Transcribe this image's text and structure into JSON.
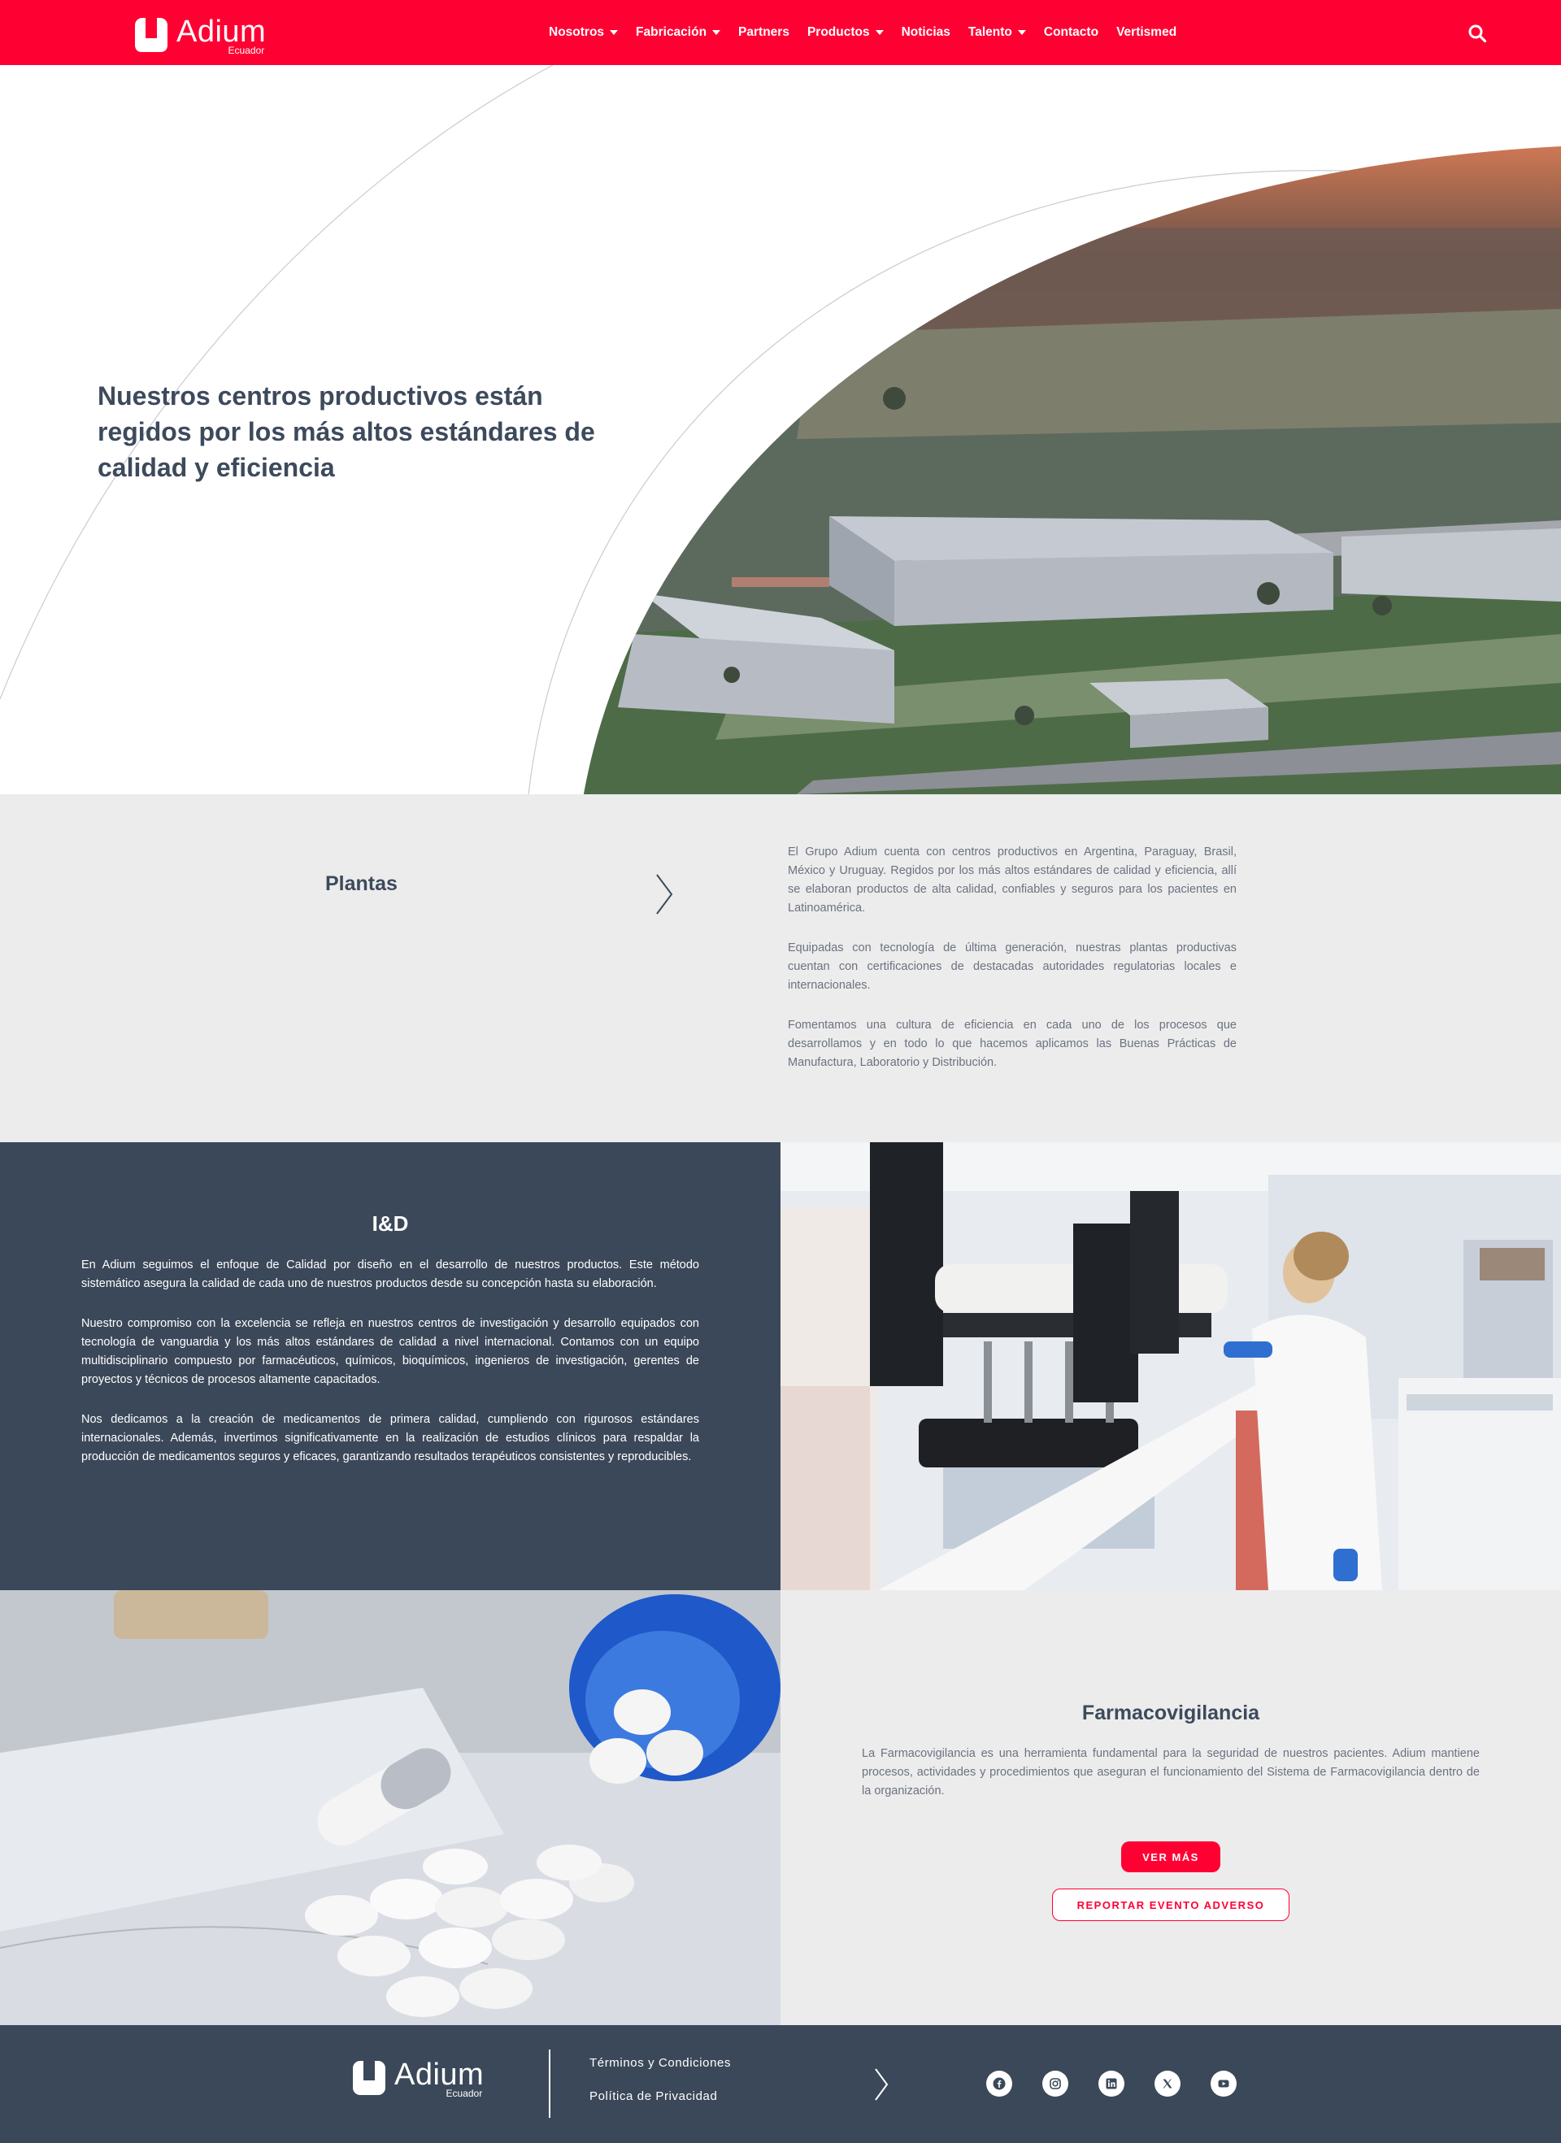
{
  "brand": {
    "name": "Adium",
    "country": "Ecuador"
  },
  "nav": {
    "items": [
      {
        "label": "Nosotros",
        "dropdown": true
      },
      {
        "label": "Fabricación",
        "dropdown": true
      },
      {
        "label": "Partners",
        "dropdown": false
      },
      {
        "label": "Productos",
        "dropdown": true
      },
      {
        "label": "Noticias",
        "dropdown": false
      },
      {
        "label": "Talento",
        "dropdown": true
      },
      {
        "label": "Contacto",
        "dropdown": false
      },
      {
        "label": "Vertismed",
        "dropdown": false
      }
    ],
    "search_icon": "search-icon"
  },
  "hero": {
    "title": "Nuestros centros productivos están regidos por los más altos estándares de calidad y eficiencia"
  },
  "plantas": {
    "heading": "Plantas",
    "paragraphs": [
      "El Grupo Adium cuenta con  centros productivos en Argentina, Paraguay, Brasil, México y Uruguay. Regidos por los más altos estándares de calidad y eficiencia, allí se elaboran productos de alta calidad, confiables y seguros para los pacientes en Latinoamérica.",
      "Equipadas con tecnología de última generación, nuestras plantas productivas cuentan con certificaciones de destacadas autoridades regulatorias locales e internacionales.",
      "Fomentamos una cultura de eficiencia en cada uno de los procesos que desarrollamos y en todo lo que hacemos aplicamos las Buenas Prácticas de Manufactura, Laboratorio y Distribución."
    ]
  },
  "iyd": {
    "heading": "I&D",
    "paragraphs": [
      "En Adium seguimos el enfoque de Calidad por diseño en el desarrollo de nuestros productos. Este método sistemático asegura la calidad de cada uno de nuestros productos desde su concepción hasta su elaboración.",
      "Nuestro compromiso con la excelencia se refleja en nuestros centros de investigación y desarrollo equipados con tecnología de vanguardia y los más altos estándares de calidad a nivel internacional. Contamos con un equipo multidisciplinario compuesto por farmacéuticos, químicos, bioquímicos, ingenieros de investigación, gerentes de proyectos y técnicos de procesos altamente capacitados.",
      "Nos dedicamos a la creación de medicamentos de primera calidad, cumpliendo con rigurosos estándares internacionales. Además, invertimos significativamente en la realización de estudios clínicos para respaldar la producción de medicamentos seguros y eficaces, garantizando resultados terapéuticos consistentes y reproducibles."
    ]
  },
  "farma": {
    "heading": "Farmacovigilancia",
    "paragraph": "La Farmacovigilancia es una herramienta fundamental para la seguridad de nuestros pacientes. Adium mantiene procesos, actividades y procedimientos que aseguran el funcionamiento del Sistema de Farmacovigilancia dentro de la organización.",
    "button_primary": "VER MÁS",
    "button_secondary": "REPORTAR EVENTO ADVERSO"
  },
  "footer": {
    "links": [
      "Términos y Condiciones",
      "Política de Privacidad"
    ],
    "socials": [
      "facebook-icon",
      "instagram-icon",
      "linkedin-icon",
      "x-icon",
      "youtube-icon"
    ]
  },
  "colors": {
    "brand_red": "#ff0033",
    "navy": "#3b4859",
    "light_gray": "#ececec",
    "heading": "#3d4a5c"
  }
}
